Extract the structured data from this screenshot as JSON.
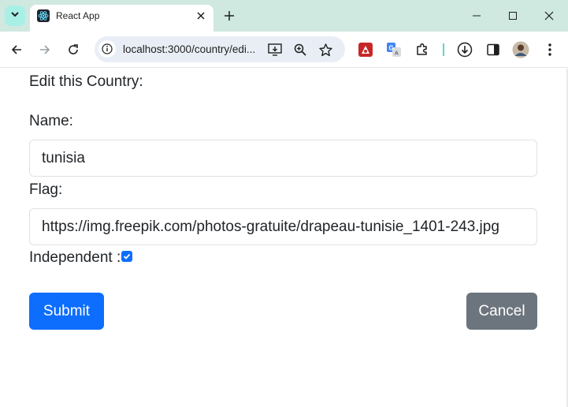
{
  "browser": {
    "tab_title": "React App",
    "url": "localhost:3000/country/edi...",
    "accent": "#cfe8e0"
  },
  "icons": {
    "tab_search": "chevron-down-icon",
    "favicon": "react-icon",
    "tab_close": "close-icon",
    "new_tab": "plus-icon",
    "minimize": "minimize-icon",
    "maximize": "maximize-icon",
    "close": "close-icon",
    "back": "arrow-left-icon",
    "forward": "arrow-right-icon",
    "reload": "reload-icon",
    "site_info": "info-icon",
    "install": "install-app-icon",
    "zoom": "zoom-icon",
    "bookmark": "star-icon",
    "extensions": [
      "extension-red-icon",
      "google-translate-icon",
      "puzzle-icon"
    ],
    "download": "download-icon",
    "side_panel": "side-panel-icon",
    "profile": "avatar",
    "menu": "more-vert-icon"
  },
  "form": {
    "heading": "Edit this Country:",
    "name_label": "Name:",
    "name_value": "tunisia",
    "flag_label": "Flag:",
    "flag_value": "https://img.freepik.com/photos-gratuite/drapeau-tunisie_1401-243.jpg",
    "independent_label": "Independent :",
    "independent_checked": true,
    "submit_label": "Submit",
    "cancel_label": "Cancel"
  },
  "colors": {
    "primary": "#0d6efd",
    "secondary": "#6c757d",
    "text": "#212529"
  }
}
